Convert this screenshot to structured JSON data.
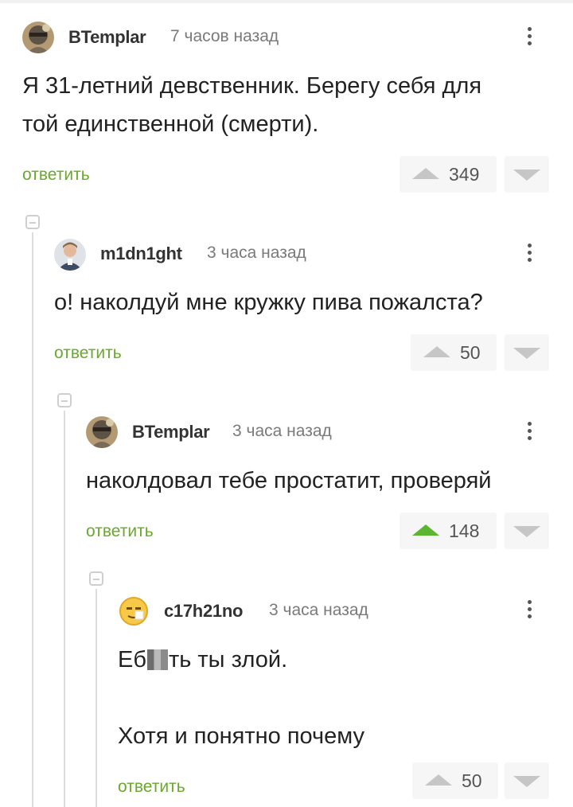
{
  "comments": [
    {
      "username": "BTemplar",
      "time": "7 часов назад",
      "text_lines": [
        "Я 31-летний девственник. Берегу себя для",
        "той единственной (смерти)."
      ],
      "reply_label": "ответить",
      "votes": "349",
      "upvoted": false,
      "avatar_icon": "helmet-avatar-icon"
    },
    {
      "username": "m1dn1ght",
      "time": "3 часа назад",
      "text_lines": [
        "о! наколдуй мне кружку пива пожалста?"
      ],
      "reply_label": "ответить",
      "votes": "50",
      "upvoted": false,
      "avatar_icon": "portrait-avatar-icon"
    },
    {
      "username": "BTemplar",
      "time": "3 часа назад",
      "text_lines": [
        "наколдовал тебе простатит, проверяй"
      ],
      "reply_label": "ответить",
      "votes": "148",
      "upvoted": true,
      "avatar_icon": "helmet-avatar-icon"
    },
    {
      "username": "c17h21no",
      "time": "3 часа назад",
      "text_line1_before": "Еб",
      "text_line1_after": "ть ты злой.",
      "text_line2": "Хотя и понятно почему",
      "reply_label": "ответить",
      "votes": "50",
      "upvoted": false,
      "avatar_icon": "emoji-avatar-icon"
    }
  ],
  "colors": {
    "reply_green": "#6aa82e",
    "upvote_active": "#5cb531",
    "vote_inactive": "#c6c6c6",
    "vote_bg": "#f6f6f6"
  }
}
